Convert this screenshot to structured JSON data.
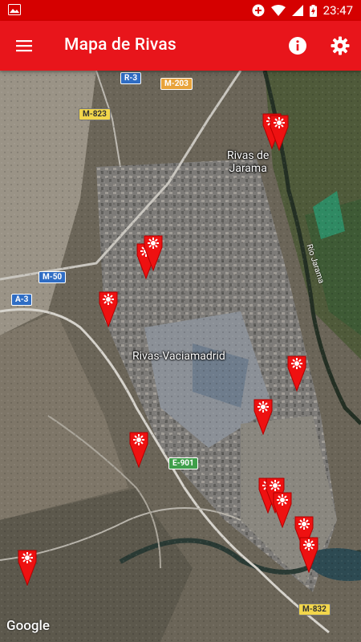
{
  "status": {
    "time": "23:47"
  },
  "appbar": {
    "title": "Mapa de Rivas"
  },
  "map": {
    "places": [
      "Rivas de Jarama",
      "Rivas-Vaciamadrid"
    ],
    "river": "Río Jarama",
    "roads": [
      "R-3",
      "M-203",
      "M-823",
      "M-50",
      "A-3",
      "E-901",
      "M-832"
    ],
    "attribution": "Google"
  },
  "colors": {
    "status_bar": "#d50000",
    "app_bar": "#e8151b",
    "marker": "#ee1111"
  }
}
